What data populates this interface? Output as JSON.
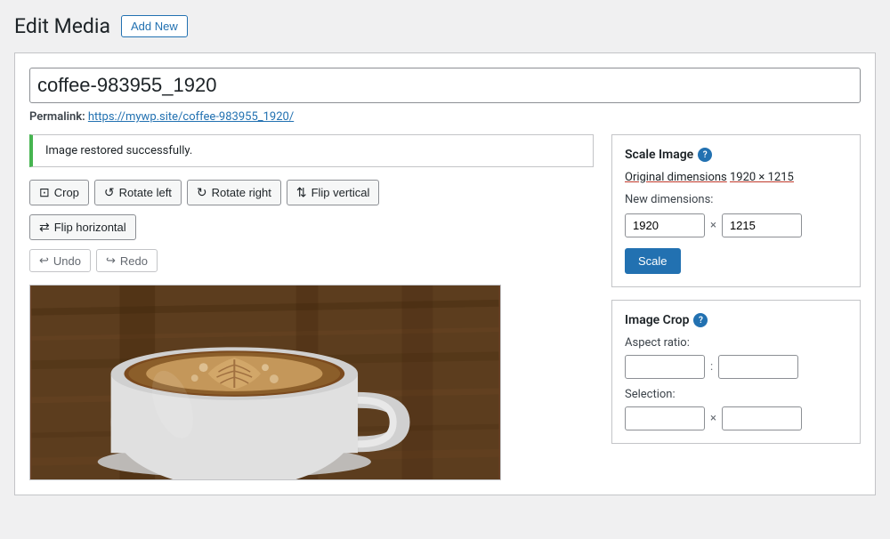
{
  "page": {
    "title": "Edit Media",
    "add_new_label": "Add New"
  },
  "filename": {
    "value": "coffee-983955_1920"
  },
  "permalink": {
    "label": "Permalink:",
    "url": "https://mywp.site/coffee-983955_1920/",
    "url_display": "https://mywp.site/coffee-983955_1920/"
  },
  "notice": {
    "message": "Image restored successfully."
  },
  "tools": {
    "crop": "Crop",
    "rotate_left": "Rotate left",
    "rotate_right": "Rotate right",
    "flip_vertical": "Flip vertical",
    "flip_horizontal": "Flip horizontal",
    "undo": "Undo",
    "redo": "Redo"
  },
  "scale_image": {
    "title": "Scale Image",
    "original_label": "Original dimensions",
    "original_dims": "1920 × 1215",
    "new_dims_label": "New dimensions:",
    "width": "1920",
    "height": "1215",
    "separator": "×",
    "scale_button": "Scale"
  },
  "image_crop": {
    "title": "Image Crop",
    "aspect_ratio_label": "Aspect ratio:",
    "aspect_separator": ":",
    "selection_label": "Selection:",
    "selection_separator": "×",
    "aspect_w": "",
    "aspect_h": "",
    "sel_w": "",
    "sel_h": ""
  }
}
